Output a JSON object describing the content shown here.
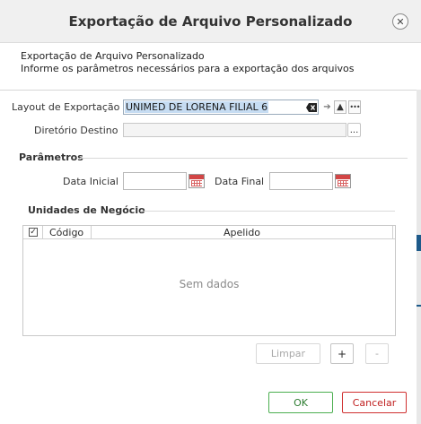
{
  "dialog": {
    "title": "Exportação de Arquivo Personalizado",
    "subtitle": "Exportação de Arquivo Personalizado",
    "description": "Informe os parâmetros necessários para a exportação dos arquivos"
  },
  "form": {
    "layout_label": "Layout de Exportação",
    "layout_value": "UNIMED DE LORENA FILIAL 6",
    "destino_label": "Diretório Destino",
    "destino_value": "",
    "browse_label": "...",
    "more_label": "•••"
  },
  "parametros": {
    "title": "Parâmetros",
    "data_inicial_label": "Data Inicial",
    "data_final_label": "Data Final",
    "data_inicial_value": "",
    "data_final_value": ""
  },
  "unidades": {
    "title": "Unidades de Negócio",
    "columns": [
      "Código",
      "Apelido"
    ],
    "rows": [],
    "empty_text": "Sem dados",
    "limpar_label": "Limpar",
    "add_label": "+",
    "remove_label": "-"
  },
  "footer": {
    "ok_label": "OK",
    "cancel_label": "Cancelar"
  },
  "colors": {
    "ok": "#4caf50",
    "cancel": "#d03030",
    "selection": "#c6dcf2",
    "calendar": "#d24545"
  }
}
